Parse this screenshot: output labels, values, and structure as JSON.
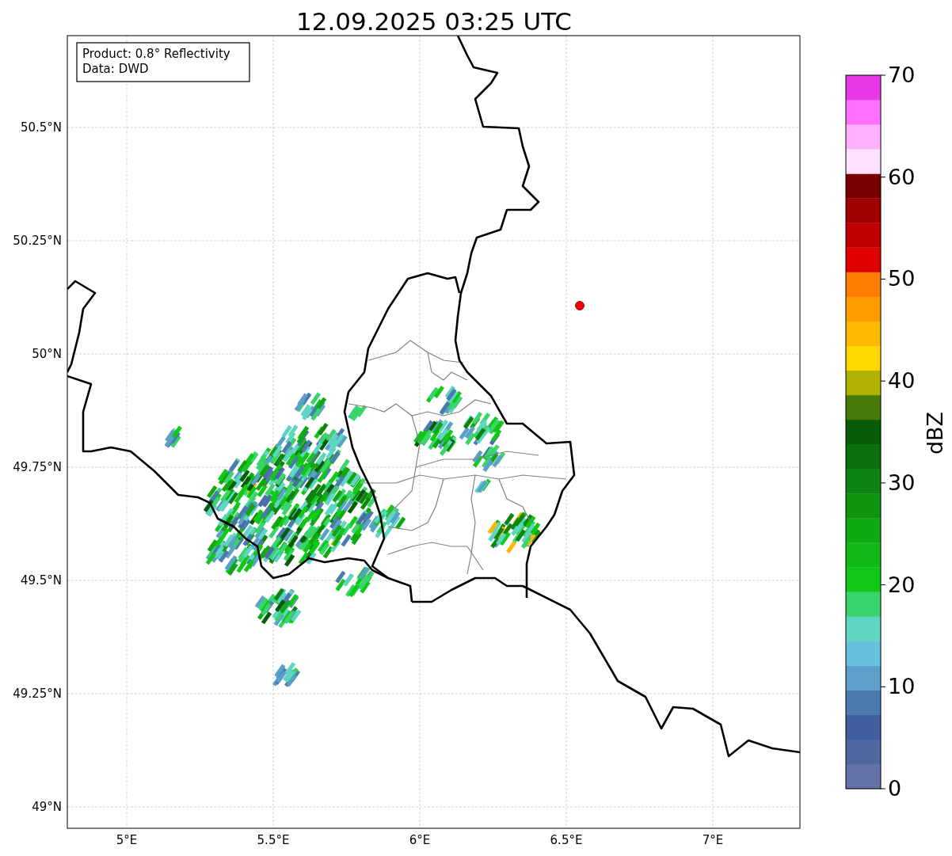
{
  "title": "12.09.2025 03:25 UTC",
  "info_box": {
    "lines": [
      "Product: 0.8° Reflectivity",
      "Data: DWD"
    ]
  },
  "y_ticks": [
    "50.5°N",
    "50.25°N",
    "50°N",
    "49.75°N",
    "49.5°N",
    "49.25°N",
    "49°N"
  ],
  "x_ticks": [
    "5°E",
    "5.5°E",
    "6°E",
    "6.5°E",
    "7°E"
  ],
  "colorbar": {
    "label": "dBZ",
    "ticks": [
      "70",
      "60",
      "50",
      "40",
      "30",
      "20",
      "10",
      "0"
    ],
    "segments": [
      {
        "color": "#6373a8"
      },
      {
        "color": "#5068a0"
      },
      {
        "color": "#405ea0"
      },
      {
        "color": "#4a7ab0"
      },
      {
        "color": "#5aa0c8"
      },
      {
        "color": "#66c2dc"
      },
      {
        "color": "#5fd6c4"
      },
      {
        "color": "#3ad46c"
      },
      {
        "color": "#10c818"
      },
      {
        "color": "#10b818"
      },
      {
        "color": "#10a810"
      },
      {
        "color": "#0f9410"
      },
      {
        "color": "#0e8410"
      },
      {
        "color": "#0a700e"
      },
      {
        "color": "#065c08"
      },
      {
        "color": "#467a0a"
      },
      {
        "color": "#b0b000"
      },
      {
        "color": "#ffd800"
      },
      {
        "color": "#ffb800"
      },
      {
        "color": "#ff9c00"
      },
      {
        "color": "#ff7c00"
      },
      {
        "color": "#e00000"
      },
      {
        "color": "#c00000"
      },
      {
        "color": "#a00000"
      },
      {
        "color": "#7a0000"
      },
      {
        "color": "#ffe0ff"
      },
      {
        "color": "#ffb0ff"
      },
      {
        "color": "#ff70ff"
      },
      {
        "color": "#e838e8"
      }
    ]
  }
}
